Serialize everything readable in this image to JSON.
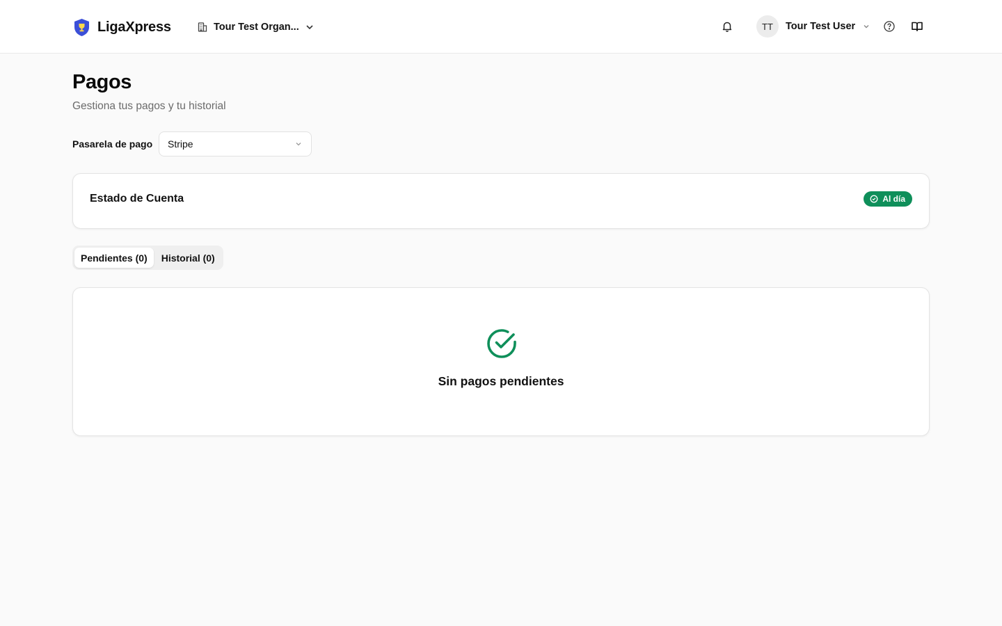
{
  "header": {
    "brand_name": "LigaXpress",
    "organization": "Tour Test Organ...",
    "user_initials": "TT",
    "user_name": "Tour Test User"
  },
  "page": {
    "title": "Pagos",
    "subtitle": "Gestiona tus pagos y tu historial"
  },
  "gateway": {
    "label": "Pasarela de pago",
    "selected": "Stripe"
  },
  "account": {
    "title": "Estado de Cuenta",
    "status": "Al día"
  },
  "tabs": [
    {
      "label": "Pendientes (0)",
      "active": true
    },
    {
      "label": "Historial (0)",
      "active": false
    }
  ],
  "empty_state": {
    "message": "Sin pagos pendientes"
  },
  "colors": {
    "brand": "#3b4fd8",
    "success": "#0f8f5a",
    "background": "#fafafa"
  },
  "icons": [
    "shield-trophy-icon",
    "building-icon",
    "chevron-down-icon",
    "bell-icon",
    "help-circle-icon",
    "book-open-icon",
    "check-circle-icon"
  ]
}
